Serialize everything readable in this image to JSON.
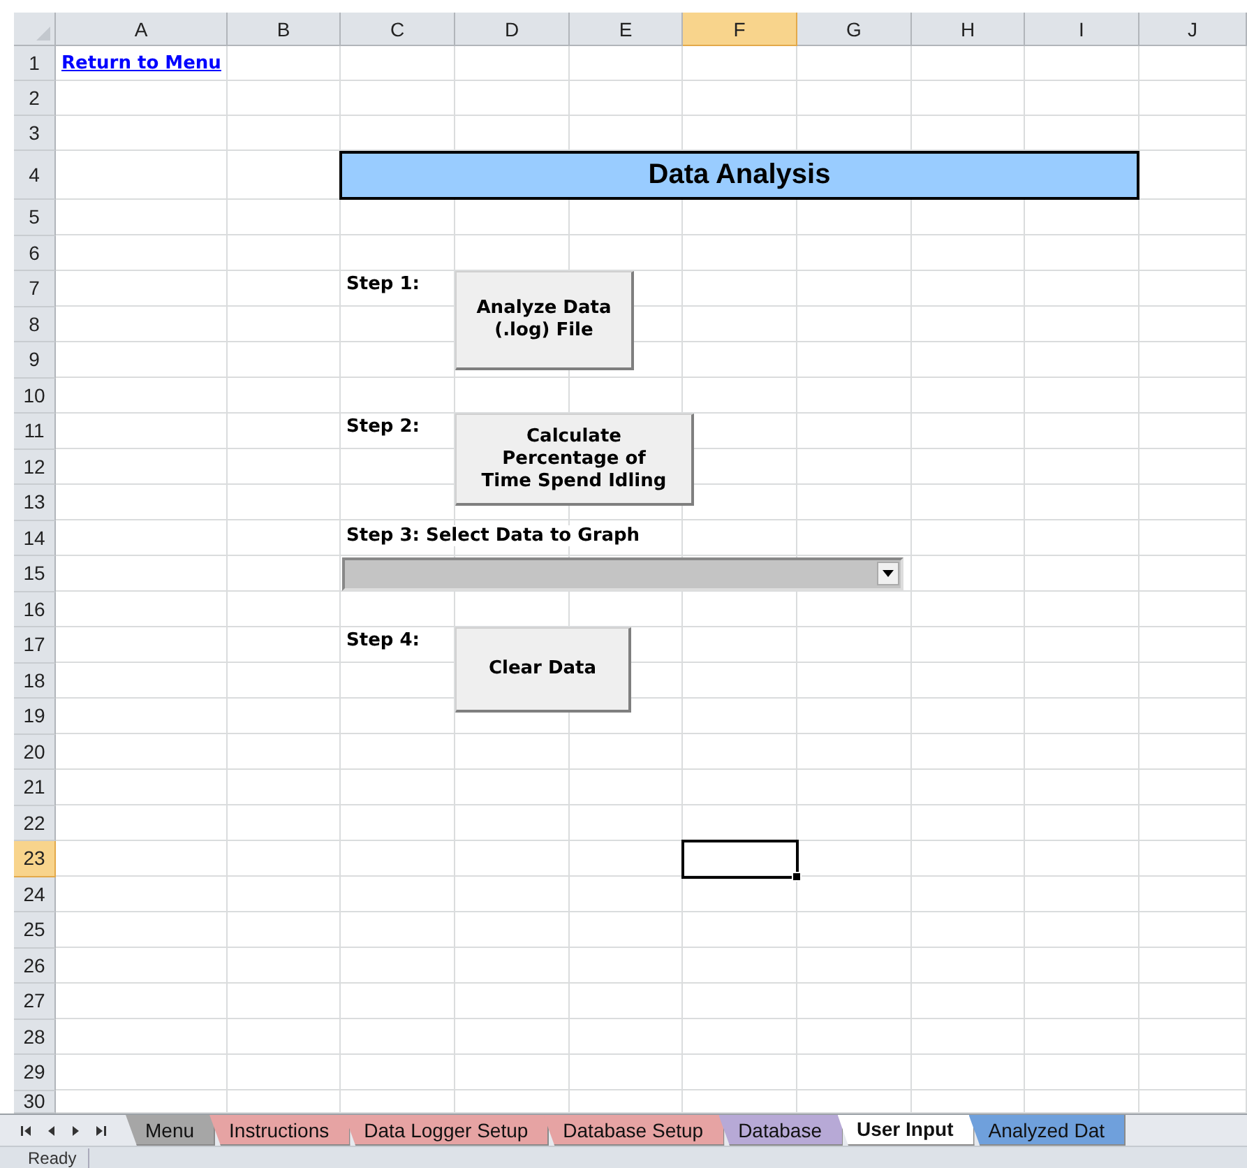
{
  "columns": [
    {
      "label": "A",
      "selected": false
    },
    {
      "label": "B",
      "selected": false
    },
    {
      "label": "C",
      "selected": false
    },
    {
      "label": "D",
      "selected": false
    },
    {
      "label": "E",
      "selected": false
    },
    {
      "label": "F",
      "selected": true
    },
    {
      "label": "G",
      "selected": false
    },
    {
      "label": "H",
      "selected": false
    },
    {
      "label": "I",
      "selected": false
    },
    {
      "label": "J",
      "selected": false
    }
  ],
  "rows": [
    {
      "label": "1",
      "selected": false
    },
    {
      "label": "2",
      "selected": false
    },
    {
      "label": "3",
      "selected": false
    },
    {
      "label": "4",
      "selected": false
    },
    {
      "label": "5",
      "selected": false
    },
    {
      "label": "6",
      "selected": false
    },
    {
      "label": "7",
      "selected": false
    },
    {
      "label": "8",
      "selected": false
    },
    {
      "label": "9",
      "selected": false
    },
    {
      "label": "10",
      "selected": false
    },
    {
      "label": "11",
      "selected": false
    },
    {
      "label": "12",
      "selected": false
    },
    {
      "label": "13",
      "selected": false
    },
    {
      "label": "14",
      "selected": false
    },
    {
      "label": "15",
      "selected": false
    },
    {
      "label": "16",
      "selected": false
    },
    {
      "label": "17",
      "selected": false
    },
    {
      "label": "18",
      "selected": false
    },
    {
      "label": "19",
      "selected": false
    },
    {
      "label": "20",
      "selected": false
    },
    {
      "label": "21",
      "selected": false
    },
    {
      "label": "22",
      "selected": false
    },
    {
      "label": "23",
      "selected": true
    },
    {
      "label": "24",
      "selected": false
    },
    {
      "label": "25",
      "selected": false
    },
    {
      "label": "26",
      "selected": false
    },
    {
      "label": "27",
      "selected": false
    },
    {
      "label": "28",
      "selected": false
    },
    {
      "label": "29",
      "selected": false
    },
    {
      "label": "30",
      "selected": false
    }
  ],
  "link": "Return to Menu",
  "title": "Data Analysis",
  "steps": [
    {
      "label": "Step 1:",
      "kind": "button",
      "button": "Analyze Data\n(.log) File"
    },
    {
      "label": "Step 2:",
      "kind": "button",
      "button": "Calculate\nPercentage of\nTime Spend Idling"
    },
    {
      "label": "Step 3: Select Data to Graph",
      "kind": "dropdown"
    },
    {
      "label": "Step 4:",
      "kind": "button",
      "button": "Clear Data"
    }
  ],
  "sheet_tabs": [
    {
      "label": "Menu",
      "color": "#a6a6a6",
      "selected": false
    },
    {
      "label": "Instructions",
      "color": "#e6a3a3",
      "selected": false
    },
    {
      "label": "Data Logger Setup",
      "color": "#e6a3a3",
      "selected": false
    },
    {
      "label": "Database Setup",
      "color": "#e6a3a3",
      "selected": false
    },
    {
      "label": "Database",
      "color": "#b7a9d6",
      "selected": false
    },
    {
      "label": "User Input",
      "color": "#ffffff",
      "selected": true
    },
    {
      "label": "Analyzed Dat",
      "color": "#6fa0dc",
      "selected": false
    }
  ],
  "status_bar": "Ready"
}
